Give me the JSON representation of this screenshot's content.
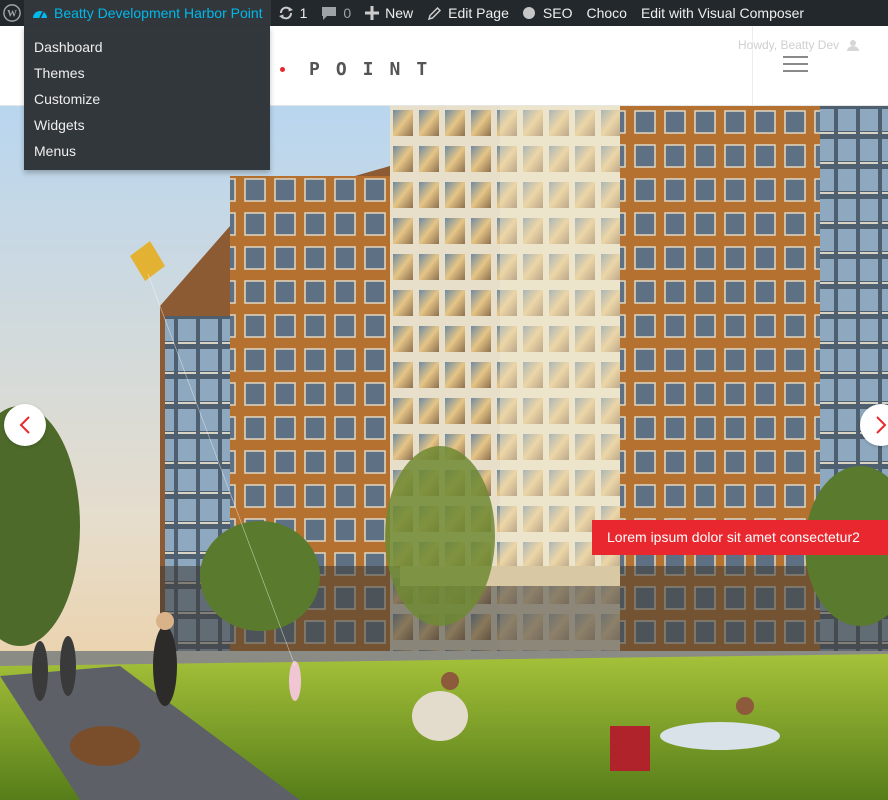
{
  "adminbar": {
    "site_name": "Beatty Development Harbor Point",
    "updates_count": "1",
    "comments_count": "0",
    "new_label": "New",
    "edit_page_label": "Edit Page",
    "seo_label": "SEO",
    "choco_label": "Choco",
    "visual_composer_label": "Edit with Visual Composer"
  },
  "site_menu": {
    "items": [
      {
        "label": "Dashboard"
      },
      {
        "label": "Themes"
      },
      {
        "label": "Customize"
      },
      {
        "label": "Widgets"
      },
      {
        "label": "Menus"
      }
    ]
  },
  "header": {
    "logo_text": "POINT",
    "howdy": "Howdy, Beatty Dev"
  },
  "slider": {
    "caption": "Lorem ipsum dolor sit amet consectetur2",
    "prev_icon": "chevron-left-icon",
    "next_icon": "chevron-right-icon"
  },
  "colors": {
    "adminbar_bg": "#23282d",
    "accent_blue": "#00b9eb",
    "accent_red": "#e8282e"
  }
}
